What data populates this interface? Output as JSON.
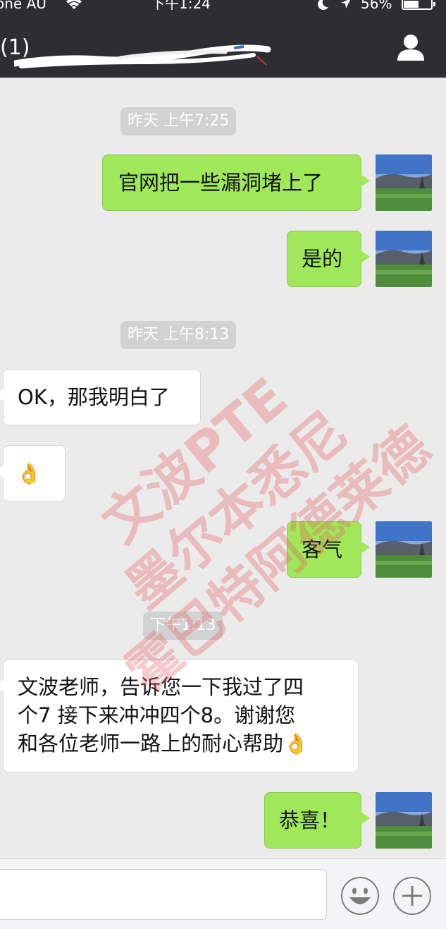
{
  "status_bar": {
    "carrier": "one AU",
    "time": "下午1:24",
    "battery": "56%",
    "battery_level": 0.56
  },
  "header": {
    "unread_count": "(1)"
  },
  "messages": [
    {
      "kind": "timestamp",
      "text": "昨天 上午7:25"
    },
    {
      "kind": "me",
      "text": "官网把一些漏洞堵上了"
    },
    {
      "kind": "me",
      "text": "是的"
    },
    {
      "kind": "timestamp",
      "text": "昨天 上午8:13"
    },
    {
      "kind": "them",
      "text": "OK，那我明白了"
    },
    {
      "kind": "them",
      "text": "👌"
    },
    {
      "kind": "me",
      "text": "客气"
    },
    {
      "kind": "timestamp",
      "text": "下午1:13"
    },
    {
      "kind": "them",
      "lines": [
        "文波老师，告诉您一下我过了四",
        "个7 接下来冲冲四个8。谢谢您",
        "和各位老师一路上的耐心帮助👌"
      ]
    },
    {
      "kind": "me",
      "text": "恭喜！"
    }
  ],
  "watermark": {
    "lines": [
      "文波PTE",
      "墨尔本悉尼",
      "霍巴特阿德莱德"
    ]
  },
  "colors": {
    "bar": "#2e2e32",
    "background": "#ebebeb",
    "my_bubble": "#a0e75a",
    "their_bubble": "#ffffff",
    "timestamp_chip": "#d2d2d2",
    "watermark": "#eb5a5f"
  },
  "icons": {
    "contact": "person-icon",
    "emoji": "smiley-icon",
    "more": "plus-icon"
  }
}
